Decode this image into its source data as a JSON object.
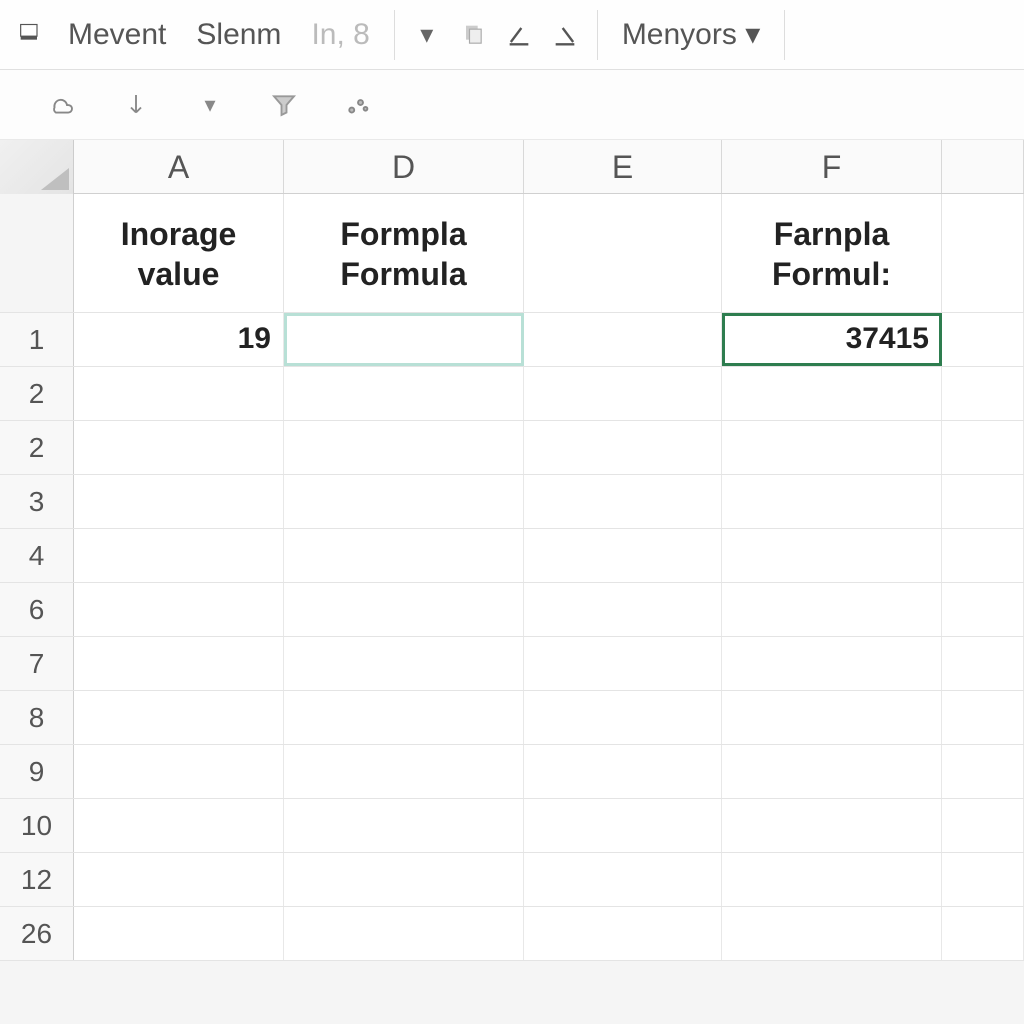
{
  "ribbon": {
    "item1": "Mevent",
    "item2": "Slenm",
    "item3": "In, 8",
    "menyors": "Menyors",
    "icons": {
      "paint": "paint-bucket-icon",
      "copy": "copy-icon",
      "under1": "underline-left-icon",
      "under2": "underline-right-icon"
    }
  },
  "columns": {
    "A": "A",
    "D": "D",
    "E": "E",
    "F": "F"
  },
  "headers": {
    "A": "Inorage\nvalue",
    "D": "Formpla\nFormula",
    "E": "",
    "F": "Farnpla\nFormul:"
  },
  "rows": [
    "1",
    "2",
    "2",
    "3",
    "4",
    "6",
    "7",
    "8",
    "9",
    "10",
    "12",
    "26"
  ],
  "cells": {
    "A1": "19",
    "D1": "",
    "F1": "37415"
  }
}
